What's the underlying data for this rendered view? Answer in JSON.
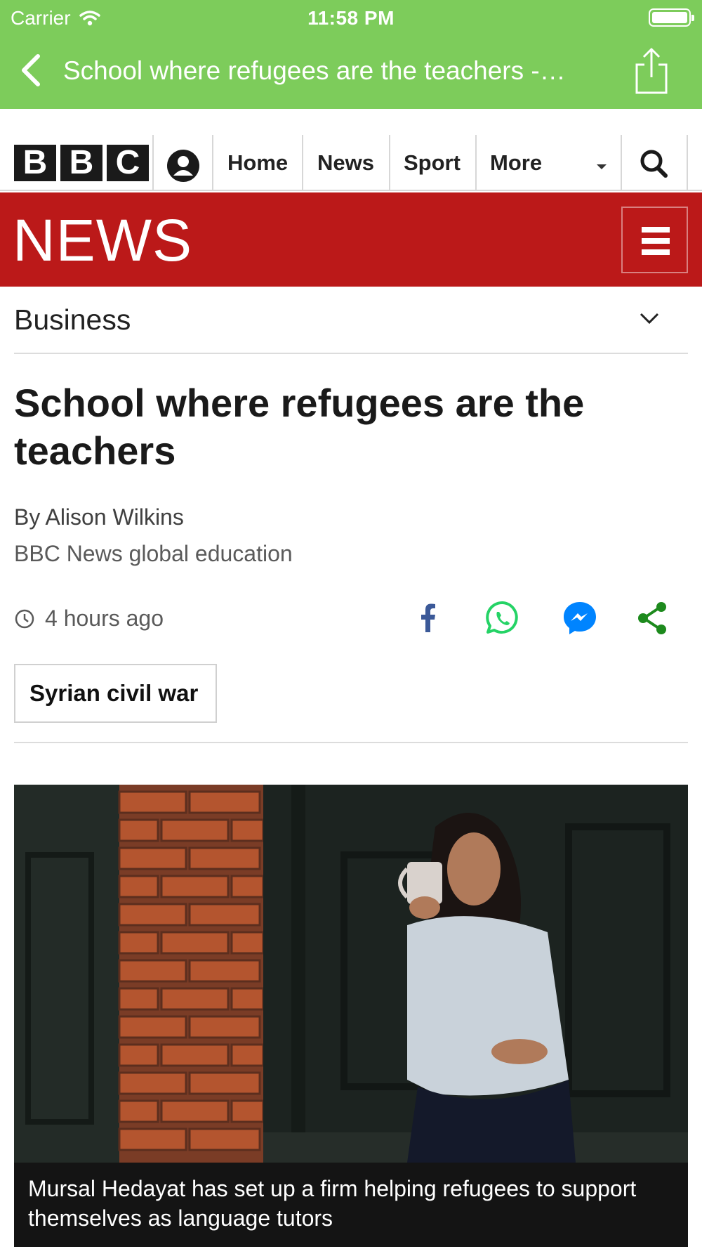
{
  "status_bar": {
    "carrier": "Carrier",
    "time": "11:58 PM"
  },
  "nav": {
    "title": "School where refugees are the teachers -…"
  },
  "bbc_header": {
    "logo_letters": [
      "B",
      "B",
      "C"
    ],
    "links": [
      "Home",
      "News",
      "Sport",
      "More"
    ]
  },
  "news_bar": {
    "logo": "NEWS"
  },
  "section": {
    "label": "Business"
  },
  "article": {
    "headline": "School where refugees are the teachers",
    "byline": "By Alison Wilkins",
    "role": "BBC News global education",
    "timestamp": "4 hours ago",
    "tag": "Syrian civil war",
    "caption": "Mursal Hedayat has set up a firm helping refugees to support themselves as language tutors"
  },
  "share": [
    "facebook-icon",
    "whatsapp-icon",
    "messenger-icon",
    "share-icon"
  ],
  "colors": {
    "nav_green": "#7dcc5b",
    "bbc_red": "#bb1919",
    "facebook": "#3b5998",
    "whatsapp": "#25d366",
    "messenger": "#0084ff",
    "share_green": "#1d8a1d"
  }
}
